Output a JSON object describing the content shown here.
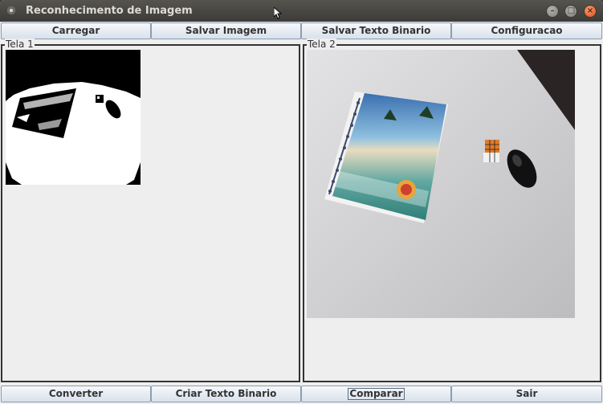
{
  "window": {
    "title": "Reconhecimento de Imagem",
    "controls": [
      "minimize",
      "maximize",
      "close"
    ]
  },
  "toolbar_top": {
    "buttons": [
      "Carregar",
      "Salvar Imagem",
      "Salvar Texto Binario",
      "Configuracao"
    ]
  },
  "panels": {
    "left": {
      "title": "Tela 1"
    },
    "right": {
      "title": "Tela 2"
    }
  },
  "toolbar_bottom": {
    "buttons": [
      "Converter",
      "Criar Texto Binario",
      "Comparar",
      "Sair"
    ],
    "focused": "Comparar"
  },
  "icons": {
    "app": "app-icon",
    "minimize": "minimize-icon",
    "maximize": "maximize-icon",
    "close": "close-icon"
  }
}
